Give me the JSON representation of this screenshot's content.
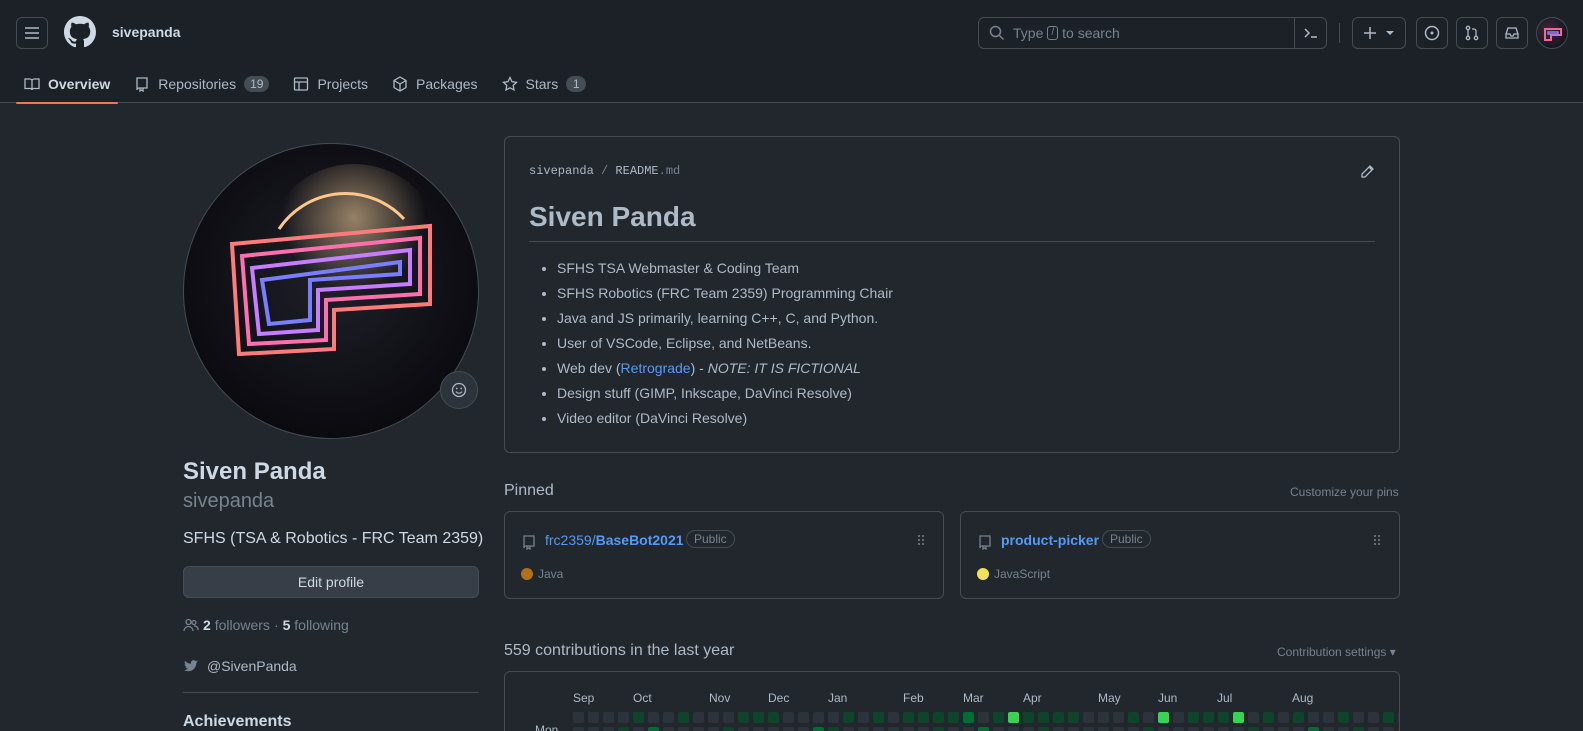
{
  "header": {
    "username": "sivepanda",
    "search_prefix": "Type",
    "search_key": "/",
    "search_suffix": "to search"
  },
  "tabs": [
    {
      "label": "Overview",
      "count": null,
      "icon": "book-icon"
    },
    {
      "label": "Repositories",
      "count": "19",
      "icon": "repo-icon"
    },
    {
      "label": "Projects",
      "count": null,
      "icon": "table-icon"
    },
    {
      "label": "Packages",
      "count": null,
      "icon": "package-icon"
    },
    {
      "label": "Stars",
      "count": "1",
      "icon": "star-icon"
    }
  ],
  "profile": {
    "fullname": "Siven Panda",
    "login": "sivepanda",
    "bio": "SFHS (TSA & Robotics - FRC Team 2359)",
    "edit_label": "Edit profile",
    "followers_count": "2",
    "followers_label": "followers",
    "following_count": "5",
    "following_label": "following",
    "twitter": "@SivenPanda",
    "achievements": "Achievements"
  },
  "readme": {
    "path_user": "sivepanda",
    "path_file": "README",
    "path_ext": ".md",
    "title": "Siven Panda",
    "items": [
      "SFHS TSA Webmaster & Coding Team",
      "SFHS Robotics (FRC Team 2359) Programming Chair",
      "Java and JS primarily, learning C++, C, and Python.",
      "User of VSCode, Eclipse, and NetBeans.",
      "Web dev (",
      "Design stuff (GIMP, Inkscape, DaVinci Resolve)",
      "Video editor (DaVinci Resolve)"
    ],
    "webdev_link": "Retrograde",
    "webdev_mid": ") - ",
    "webdev_note": "NOTE: IT IS FICTIONAL"
  },
  "pinned": {
    "title": "Pinned",
    "customize": "Customize your pins",
    "repos": [
      {
        "owner": "frc2359/",
        "name": "BaseBot2021",
        "visibility": "Public",
        "language": "Java",
        "lang_color": "#b07219"
      },
      {
        "owner": "",
        "name": "product-picker",
        "visibility": "Public",
        "language": "JavaScript",
        "lang_color": "#f1e05a"
      }
    ]
  },
  "contributions": {
    "title": "559 contributions in the last year",
    "settings": "Contribution settings ▾",
    "months": [
      "Sep",
      "Oct",
      "Nov",
      "Dec",
      "Jan",
      "Feb",
      "Mar",
      "Apr",
      "May",
      "Jun",
      "Jul",
      "Aug"
    ],
    "day_label": "Mon",
    "levels_row0": [
      0,
      0,
      0,
      0,
      1,
      0,
      0,
      1,
      0,
      0,
      0,
      1,
      1,
      1,
      0,
      0,
      0,
      0,
      1,
      0,
      1,
      0,
      1,
      1,
      1,
      1,
      2,
      0,
      1,
      4,
      1,
      1,
      1,
      1,
      0,
      0,
      0,
      1,
      0,
      4,
      0,
      1,
      1,
      1,
      4,
      0,
      1,
      0,
      1,
      0,
      0,
      1,
      0,
      0,
      1,
      0,
      0
    ],
    "level_colors": [
      "#2d333b",
      "#0e4429",
      "#006d32",
      "#26a641",
      "#39d353"
    ]
  }
}
